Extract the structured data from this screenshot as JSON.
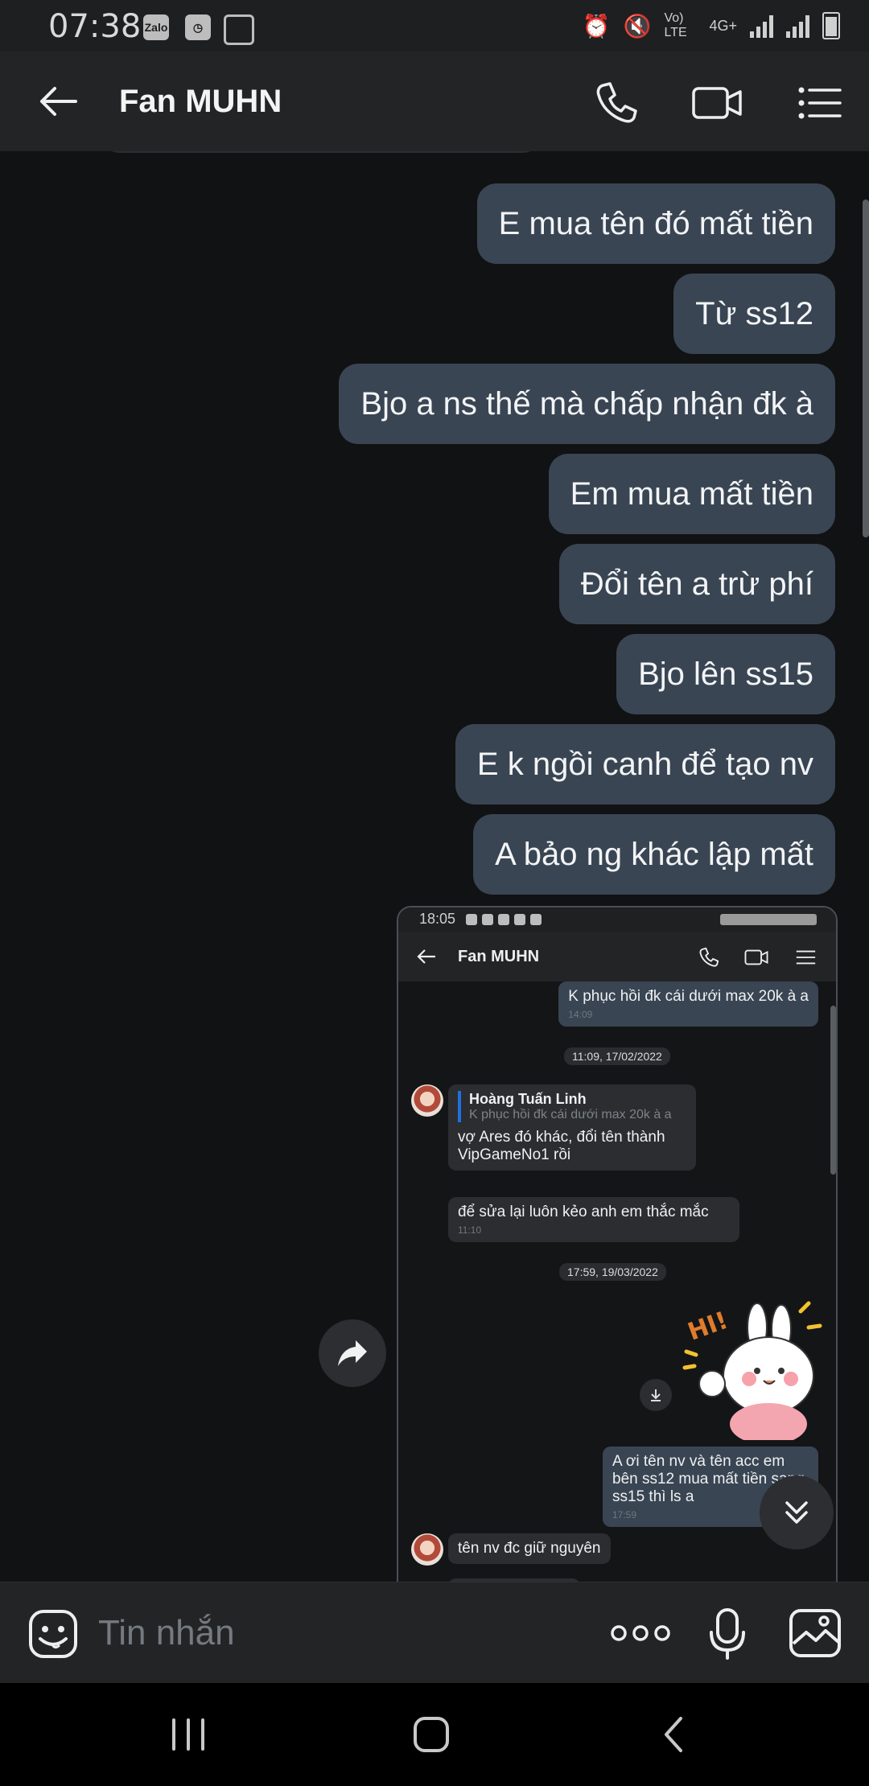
{
  "status_bar": {
    "time": "07:38",
    "notification_icons": [
      "Zalo",
      "clock-icon",
      "image-icon"
    ],
    "right_labels": [
      "Vo) LTE",
      "4G+"
    ]
  },
  "header": {
    "contact_name": "Fan MUHN"
  },
  "messages": [
    {
      "text": "E mua  tên đó mất tiền"
    },
    {
      "text": "Từ ss12"
    },
    {
      "text": "Bjo a ns thế mà chấp nhận đk à"
    },
    {
      "text": "Em mua mất tiền"
    },
    {
      "text": "Đổi tên a trừ phí"
    },
    {
      "text": "Bjo lên ss15"
    },
    {
      "text": "E k ngồi canh để tạo nv"
    },
    {
      "text": "A bảo ng khác lập mất"
    }
  ],
  "embedded_screenshot": {
    "time": "18:05",
    "contact_name": "Fan MUHN",
    "msg1": {
      "text": "K phục hồi đk cái dưới max 20k à a",
      "time": "14:09"
    },
    "date1": "11:09, 17/02/2022",
    "quote": {
      "name": "Hoàng Tuấn Linh",
      "text": "K phục hồi đk cái dưới max 20k à a"
    },
    "msg2": {
      "text": "vợ Ares đó khác, đổi tên thành VipGameNo1 rồi"
    },
    "msg3": {
      "text": "để sửa lại luôn kẻo anh em thắc mắc",
      "time": "11:10"
    },
    "date2": "17:59, 19/03/2022",
    "sticker_text": "HI!",
    "msg4": {
      "text": "A ơi tên nv và tên acc em bên ss12 mua mất tiền sang ss15 thì ls a",
      "time": "17:59"
    },
    "msg5": {
      "text": "tên nv đc giữ nguyên"
    }
  },
  "input": {
    "placeholder": "Tin nhắn"
  },
  "colors": {
    "background": "#111213",
    "bubble_me": "#3a4553",
    "header": "#232426",
    "accent_quote": "#1f6fe0"
  }
}
